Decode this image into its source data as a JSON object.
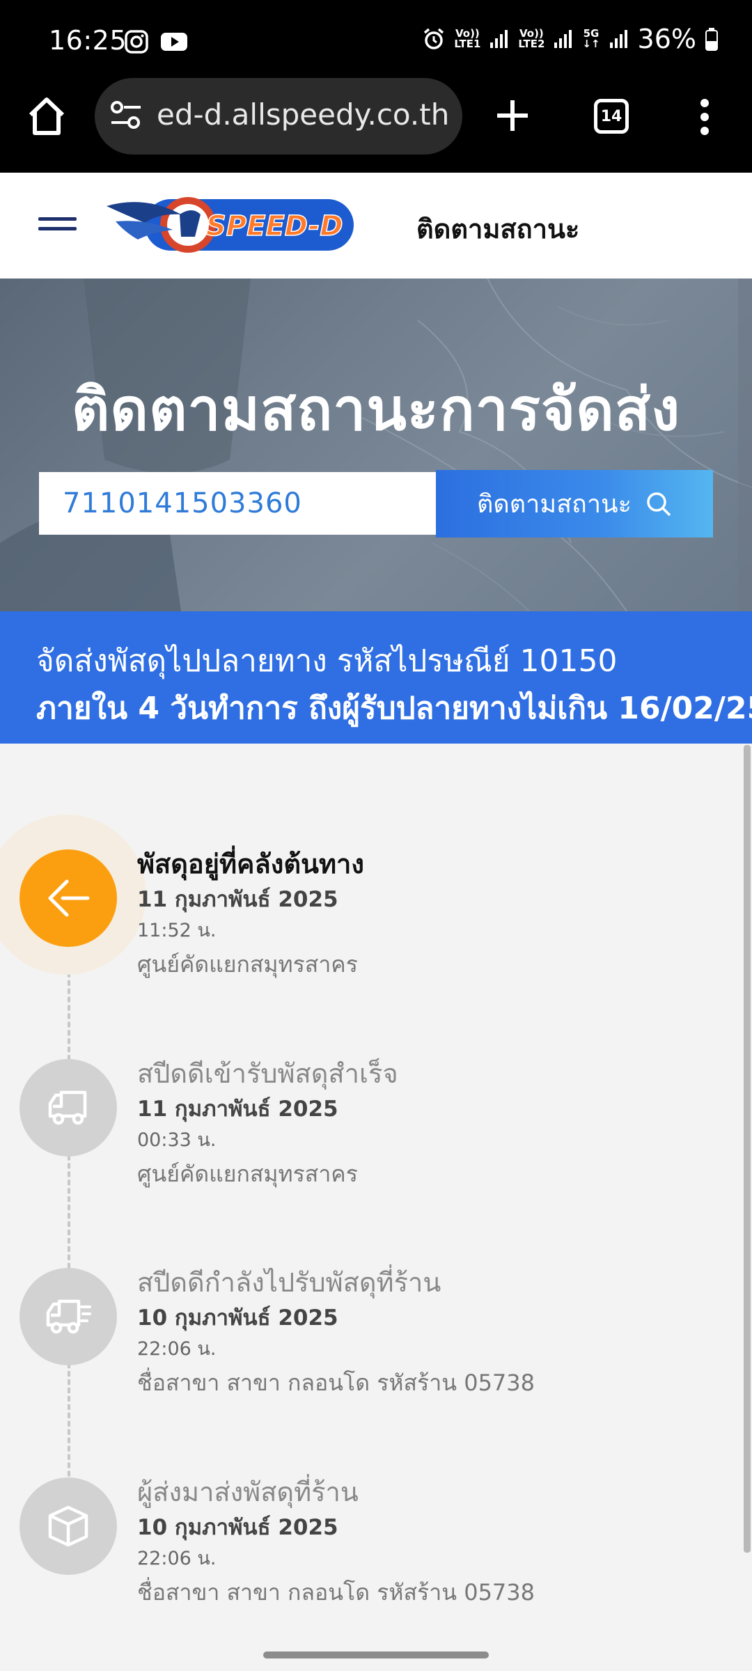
{
  "status_bar": {
    "time": "16:25",
    "sim1_top": "Vo))",
    "sim1_bottom": "LTE1",
    "sim2_top": "Vo))",
    "sim2_bottom": "LTE2",
    "network": "5G",
    "battery": "36%"
  },
  "browser": {
    "url": "ed-d.allspeedy.co.th",
    "tab_count": "14"
  },
  "header": {
    "logo_text": "SPEED-D",
    "nav_label": "ติดตามสถานะ"
  },
  "hero": {
    "title": "ติดตามสถานะการจัดส่ง",
    "tracking_number": "7110141503360",
    "button_label": "ติดตามสถานะ"
  },
  "info": {
    "line1": "จัดส่งพัสดุไปปลายทาง รหัสไปรษณีย์ 10150",
    "line2": "ภายใน 4 วันทำการ ถึงผู้รับปลายทางไม่เกิน 16/02/25"
  },
  "timeline": [
    {
      "title": "พัสดุอยู่ที่คลังต้นทาง",
      "date": "11 กุมภาพันธ์ 2025",
      "time": "11:52 น.",
      "location": "ศูนย์คัดแยกสมุทรสาคร",
      "icon": "warehouse-fork-icon",
      "active": true
    },
    {
      "title": "สปีดดีเข้ารับพัสดุสำเร็จ",
      "date": "11 กุมภาพันธ์ 2025",
      "time": "00:33 น.",
      "location": "ศูนย์คัดแยกสมุทรสาคร",
      "icon": "truck-icon",
      "active": false
    },
    {
      "title": "สปีดดีกำลังไปรับพัสดุที่ร้าน",
      "date": "10 กุมภาพันธ์ 2025",
      "time": "22:06 น.",
      "location": "ชื่อสาขา สาขา กลอนโด รหัสร้าน 05738",
      "icon": "moving-truck-icon",
      "active": false
    },
    {
      "title": "ผู้ส่งมาส่งพัสดุที่ร้าน",
      "date": "10 กุมภาพันธ์ 2025",
      "time": "22:06 น.",
      "location": "ชื่อสาขา สาขา กลอนโด รหัสร้าน 05738",
      "icon": "package-box-icon",
      "active": false
    }
  ],
  "colors": {
    "accent_blue": "#2f6fe3",
    "active_orange": "#fb9f10",
    "inactive_gray": "#d2d2d2"
  }
}
